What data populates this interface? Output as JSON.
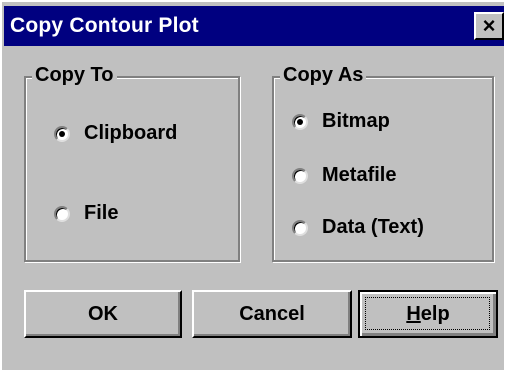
{
  "dialog": {
    "title": "Copy Contour Plot",
    "close_glyph": "×",
    "close_icon": "close-icon"
  },
  "copy_to": {
    "legend": "Copy To",
    "options": [
      {
        "label": "Clipboard",
        "checked": true
      },
      {
        "label": "File",
        "checked": false
      }
    ]
  },
  "copy_as": {
    "legend": "Copy As",
    "options": [
      {
        "label": "Bitmap",
        "checked": true
      },
      {
        "label": "Metafile",
        "checked": false
      },
      {
        "label": "Data (Text)",
        "checked": false
      }
    ]
  },
  "buttons": {
    "ok": "OK",
    "cancel": "Cancel",
    "help_mnemonic": "H",
    "help_rest": "elp"
  },
  "colors": {
    "titlebar": "#000080",
    "face": "#c0c0c0"
  }
}
